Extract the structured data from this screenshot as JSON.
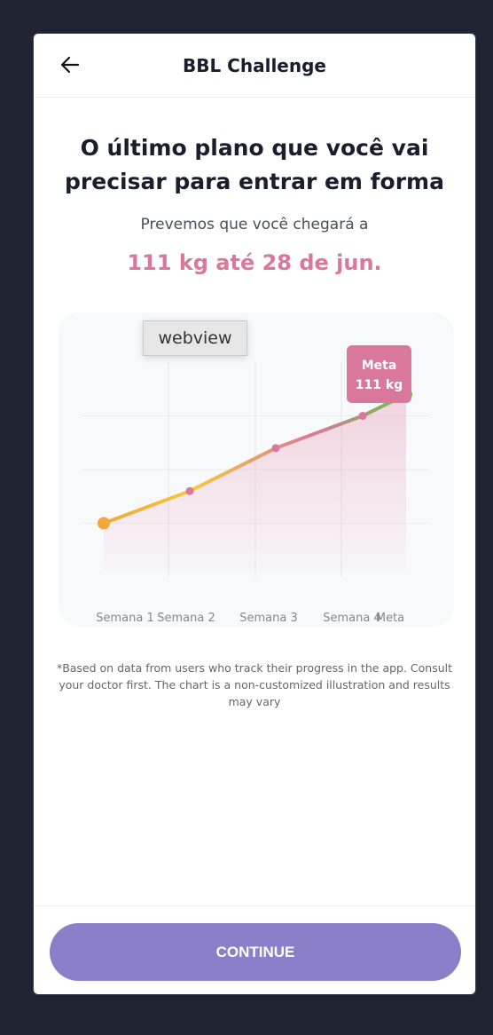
{
  "header": {
    "title": "BBL Challenge",
    "back_icon": "arrow-left-icon"
  },
  "headline": "O último plano que você vai precisar para entrar em forma",
  "subtitle": "Prevemos que você chegará a",
  "goal": "111 kg até 28 de jun.",
  "tooltip": "webview",
  "meta_badge": {
    "line1": "Meta",
    "line2": "111 kg"
  },
  "chart_data": {
    "type": "line",
    "categories": [
      "Semana 1",
      "Semana 2",
      "Semana 3",
      "Semana 4",
      "Meta"
    ],
    "values": [
      0,
      0.6,
      1.4,
      2.0,
      2.4
    ],
    "ylim": [
      -1,
      3
    ],
    "title": "",
    "xlabel": "",
    "ylabel": "",
    "grid": true,
    "colors": {
      "start": "#f2a73b",
      "mid": "#f5c842",
      "pink": "#d9789a",
      "end": "#6cc24a"
    }
  },
  "note": "*Based on data from users who track their progress in the app. Consult your doctor first. The chart is a non-customized illustration and results may vary",
  "continue_label": "CONTINUE"
}
